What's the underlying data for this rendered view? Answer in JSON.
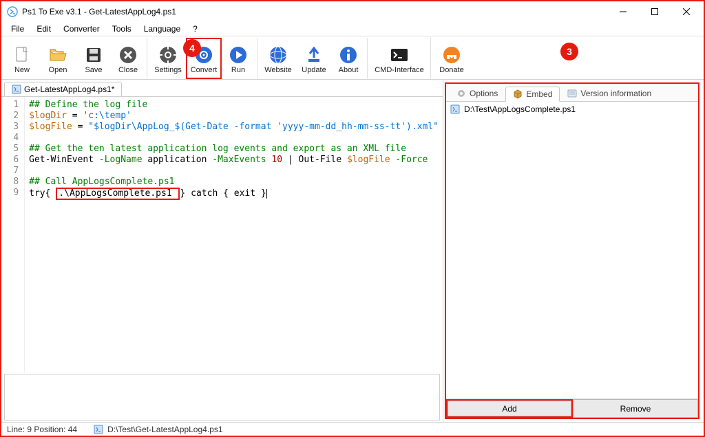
{
  "window": {
    "title": "Ps1 To Exe v3.1 - Get-LatestAppLog4.ps1"
  },
  "menu": {
    "items": [
      "File",
      "Edit",
      "Converter",
      "Tools",
      "Language",
      "?"
    ]
  },
  "toolbar": {
    "new": "New",
    "open": "Open",
    "save": "Save",
    "close": "Close",
    "settings": "Settings",
    "convert": "Convert",
    "run": "Run",
    "website": "Website",
    "update": "Update",
    "about": "About",
    "cmd": "CMD-Interface",
    "donate": "Donate"
  },
  "editor_tab": {
    "label": "Get-LatestAppLog4.ps1*"
  },
  "code": {
    "lines": [
      {
        "n": "1",
        "seg": [
          {
            "t": "## Define the log file",
            "c": "c-cmt"
          }
        ]
      },
      {
        "n": "2",
        "seg": [
          {
            "t": "$logDir",
            "c": "c-var"
          },
          {
            "t": " = "
          },
          {
            "t": "'c:\\temp'",
            "c": "c-str"
          }
        ]
      },
      {
        "n": "3",
        "seg": [
          {
            "t": "$logFile",
            "c": "c-var"
          },
          {
            "t": " = "
          },
          {
            "t": "\"$logDir\\AppLog_$(Get-Date -format 'yyyy-mm-dd_hh-mm-ss-tt').xml\"",
            "c": "c-str"
          }
        ]
      },
      {
        "n": "4",
        "seg": []
      },
      {
        "n": "5",
        "seg": [
          {
            "t": "## Get the ten latest application log events and export as an XML file",
            "c": "c-cmt"
          }
        ]
      },
      {
        "n": "6",
        "seg": [
          {
            "t": "Get-WinEvent "
          },
          {
            "t": "-LogName",
            "c": "c-kw"
          },
          {
            "t": " application "
          },
          {
            "t": "-MaxEvents",
            "c": "c-kw"
          },
          {
            "t": " "
          },
          {
            "t": "10",
            "c": "c-num"
          },
          {
            "t": " | Out-File "
          },
          {
            "t": "$logFile",
            "c": "c-var"
          },
          {
            "t": " "
          },
          {
            "t": "-Force",
            "c": "c-kw"
          }
        ]
      },
      {
        "n": "7",
        "seg": []
      },
      {
        "n": "8",
        "seg": [
          {
            "t": "## Call AppLogsComplete.ps1",
            "c": "c-cmt"
          }
        ]
      },
      {
        "n": "9",
        "hl": true,
        "pre": "try{ ",
        "hlTxt": ".\\AppLogsComplete.ps1 ",
        "post": "} catch { exit }"
      }
    ]
  },
  "right_tabs": {
    "options": "Options",
    "embed": "Embed",
    "version": "Version information"
  },
  "embed": {
    "file": "D:\\Test\\AppLogsComplete.ps1",
    "add": "Add",
    "remove": "Remove"
  },
  "status": {
    "pos": "Line: 9 Position: 44",
    "file": "D:\\Test\\Get-LatestAppLog4.ps1"
  },
  "callouts": {
    "c3": "3",
    "c4": "4"
  }
}
